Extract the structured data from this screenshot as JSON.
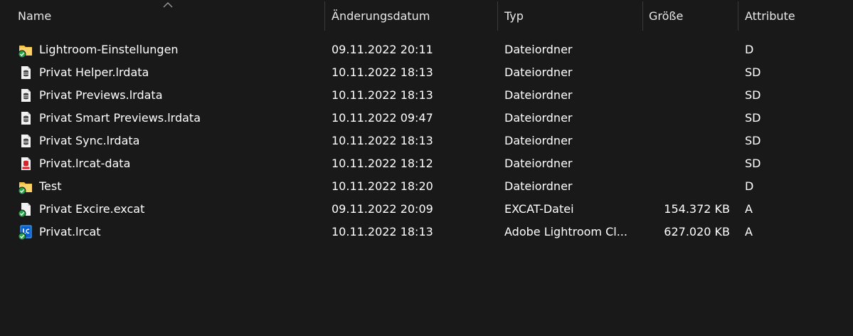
{
  "columns": {
    "name": "Name",
    "date": "Änderungsdatum",
    "type": "Typ",
    "size": "Größe",
    "attributes": "Attribute"
  },
  "sort": {
    "column": "name",
    "direction": "ascending"
  },
  "colors": {
    "background": "#191919",
    "text": "#ffffff",
    "separator": "#3a3a3a",
    "folder": "#f3c04a",
    "sync_check": "#22a74a",
    "lrcat_blue": "#0a5fd0",
    "lrcat_border": "#3da3ff",
    "data_red": "#d8242a"
  },
  "files": [
    {
      "icon": "folder-icon",
      "name": "Lightroom-Einstellungen",
      "date": "09.11.2022 20:11",
      "type": "Dateiordner",
      "size": "",
      "attributes": "D"
    },
    {
      "icon": "lrdata-file-icon",
      "name": "Privat Helper.lrdata",
      "date": "10.11.2022 18:13",
      "type": "Dateiordner",
      "size": "",
      "attributes": "SD"
    },
    {
      "icon": "lrdata-file-icon",
      "name": "Privat Previews.lrdata",
      "date": "10.11.2022 18:13",
      "type": "Dateiordner",
      "size": "",
      "attributes": "SD"
    },
    {
      "icon": "lrdata-file-icon",
      "name": "Privat Smart Previews.lrdata",
      "date": "10.11.2022 09:47",
      "type": "Dateiordner",
      "size": "",
      "attributes": "SD"
    },
    {
      "icon": "lrdata-file-icon",
      "name": "Privat Sync.lrdata",
      "date": "10.11.2022 18:13",
      "type": "Dateiordner",
      "size": "",
      "attributes": "SD"
    },
    {
      "icon": "lrcat-data-icon",
      "name": "Privat.lrcat-data",
      "date": "10.11.2022 18:12",
      "type": "Dateiordner",
      "size": "",
      "attributes": "SD"
    },
    {
      "icon": "folder-icon",
      "name": "Test",
      "date": "10.11.2022 18:20",
      "type": "Dateiordner",
      "size": "",
      "attributes": "D"
    },
    {
      "icon": "excat-file-icon",
      "name": "Privat Excire.excat",
      "date": "09.11.2022 20:09",
      "type": "EXCAT-Datei",
      "size": "154.372 KB",
      "attributes": "A"
    },
    {
      "icon": "lrcat-file-icon",
      "name": "Privat.lrcat",
      "date": "10.11.2022 18:13",
      "type": "Adobe Lightroom Cl...",
      "size": "627.020 KB",
      "attributes": "A"
    }
  ]
}
